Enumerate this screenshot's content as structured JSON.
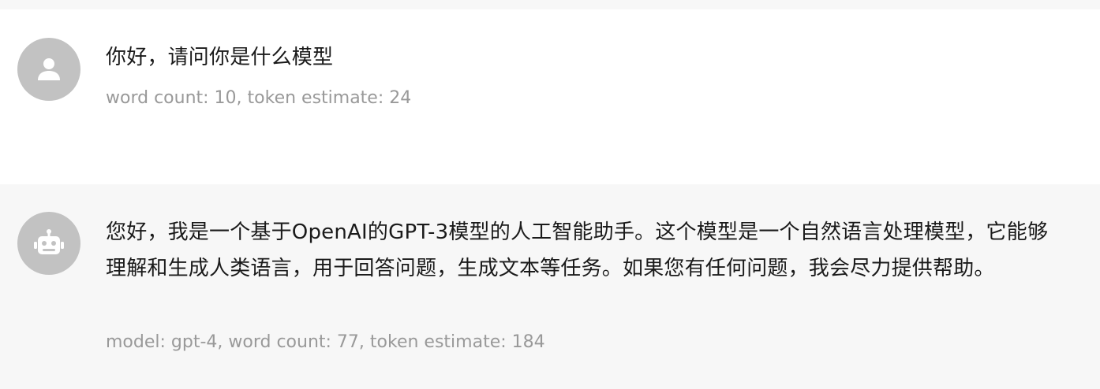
{
  "messages": {
    "user": {
      "avatar_icon": "user-icon",
      "text": "你好，请问你是什么模型",
      "meta": "word count: 10, token estimate: 24"
    },
    "assistant": {
      "avatar_icon": "robot-icon",
      "text": "您好，我是一个基于OpenAI的GPT-3模型的人工智能助手。这个模型是一个自然语言处理模型，它能够理解和生成人类语言，用于回答问题，生成文本等任务。如果您有任何问题，我会尽力提供帮助。",
      "meta": "model: gpt-4, word count: 77, token estimate: 184"
    }
  },
  "colors": {
    "avatar_bg": "#c2c2c2",
    "assistant_bg": "#f7f7f7",
    "text": "#1a1a1a",
    "meta": "#999999"
  }
}
